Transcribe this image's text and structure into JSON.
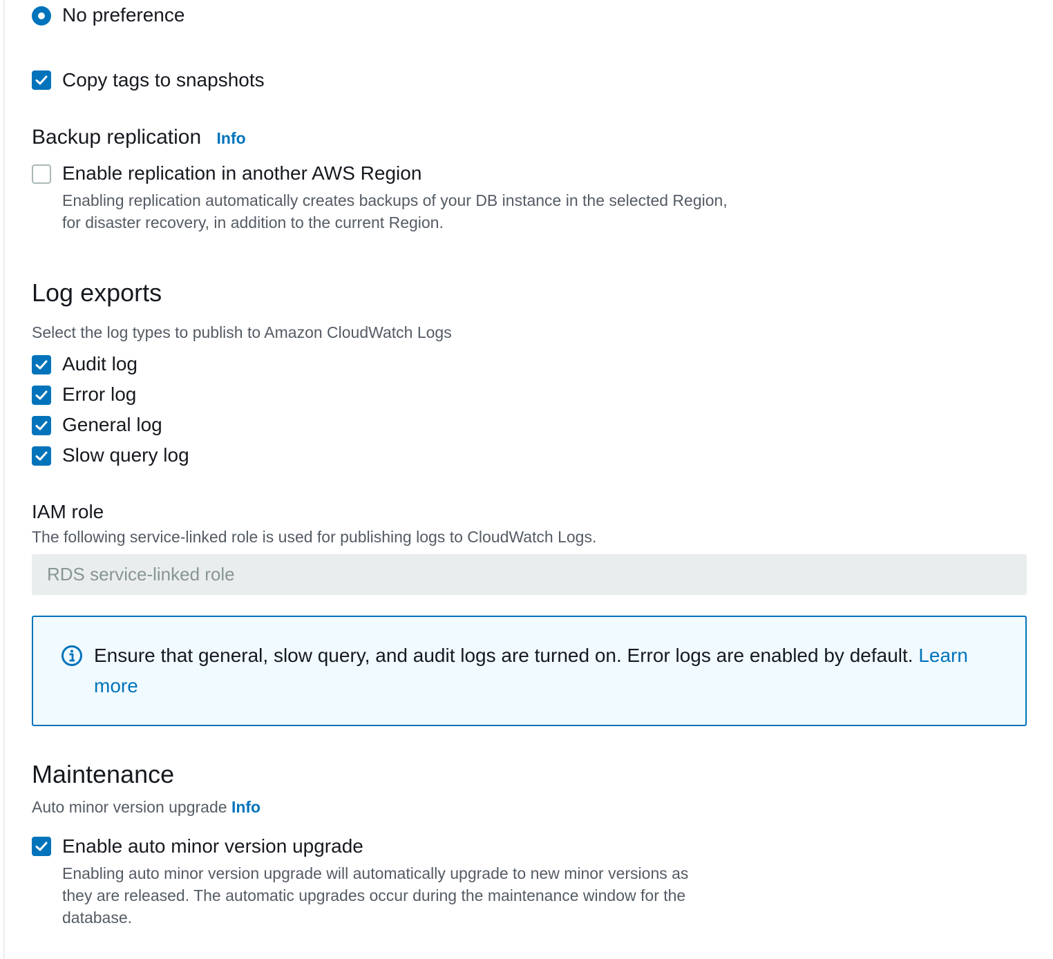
{
  "backup": {
    "no_preference_label": "No preference",
    "copy_tags_label": "Copy tags to snapshots",
    "copy_tags_checked": true
  },
  "backup_replication": {
    "heading": "Backup replication",
    "info_label": "Info",
    "enable_label": "Enable replication in another AWS Region",
    "enable_checked": false,
    "description_line1": "Enabling replication automatically creates backups of your DB instance in the selected Region,",
    "description_line2": "for disaster recovery, in addition to the current Region."
  },
  "log_exports": {
    "heading": "Log exports",
    "description": "Select the log types to publish to Amazon CloudWatch Logs",
    "items": [
      {
        "label": "Audit log",
        "checked": true
      },
      {
        "label": "Error log",
        "checked": true
      },
      {
        "label": "General log",
        "checked": true
      },
      {
        "label": "Slow query log",
        "checked": true
      }
    ]
  },
  "iam_role": {
    "heading": "IAM role",
    "description": "The following service-linked role is used for publishing logs to CloudWatch Logs.",
    "value": "RDS service-linked role"
  },
  "alert": {
    "text": "Ensure that general, slow query, and audit logs are turned on. Error logs are enabled by default.",
    "link_label": "Learn more",
    "icon": "info-circle-icon"
  },
  "maintenance": {
    "heading": "Maintenance",
    "subheading": "Auto minor version upgrade",
    "info_label": "Info",
    "enable_label": "Enable auto minor version upgrade",
    "enable_checked": true,
    "description_line1": "Enabling auto minor version upgrade will automatically upgrade to new minor versions as",
    "description_line2": "they are released. The automatic upgrades occur during the maintenance window for the",
    "description_line3": "database."
  },
  "colors": {
    "accent": "#0073bb",
    "text": "#16191f",
    "secondary_text": "#545b64",
    "disabled_bg": "#eaeded",
    "alert_bg": "#f1faff"
  }
}
